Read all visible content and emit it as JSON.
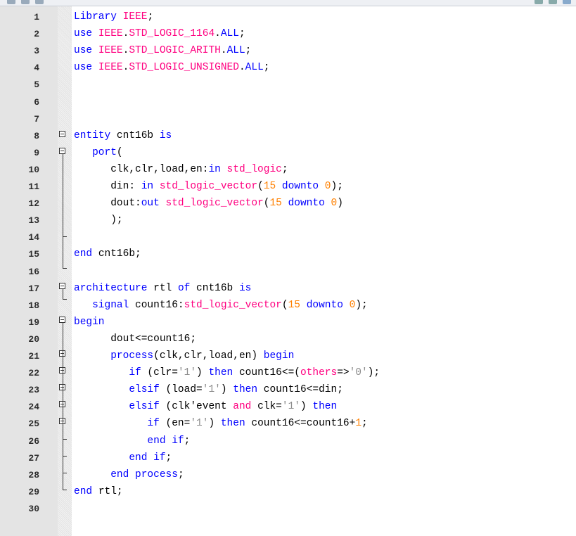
{
  "editor": {
    "line_numbers": [
      "1",
      "2",
      "3",
      "4",
      "5",
      "6",
      "7",
      "8",
      "9",
      "10",
      "11",
      "12",
      "13",
      "14",
      "15",
      "16",
      "17",
      "18",
      "19",
      "20",
      "21",
      "22",
      "23",
      "24",
      "25",
      "26",
      "27",
      "28",
      "29",
      "30"
    ],
    "lines": [
      [
        [
          "Library ",
          "kw"
        ],
        [
          "IEEE",
          "ty"
        ],
        [
          ";",
          "id"
        ]
      ],
      [
        [
          "use ",
          "kw"
        ],
        [
          "IEEE",
          "ty"
        ],
        [
          ".",
          "id"
        ],
        [
          "STD_LOGIC_1164",
          "ty"
        ],
        [
          ".",
          "id"
        ],
        [
          "ALL",
          "kw"
        ],
        [
          ";",
          "id"
        ]
      ],
      [
        [
          "use ",
          "kw"
        ],
        [
          "IEEE",
          "ty"
        ],
        [
          ".",
          "id"
        ],
        [
          "STD_LOGIC_ARITH",
          "ty"
        ],
        [
          ".",
          "id"
        ],
        [
          "ALL",
          "kw"
        ],
        [
          ";",
          "id"
        ]
      ],
      [
        [
          "use ",
          "kw"
        ],
        [
          "IEEE",
          "ty"
        ],
        [
          ".",
          "id"
        ],
        [
          "STD_LOGIC_UNSIGNED",
          "ty"
        ],
        [
          ".",
          "id"
        ],
        [
          "ALL",
          "kw"
        ],
        [
          ";",
          "id"
        ]
      ],
      [],
      [],
      [],
      [
        [
          "entity ",
          "kw"
        ],
        [
          "cnt16b ",
          "id"
        ],
        [
          "is",
          "kw"
        ]
      ],
      [
        [
          "   port",
          "kw"
        ],
        [
          "(",
          "id"
        ]
      ],
      [
        [
          "      clk,clr,load,en:",
          "id"
        ],
        [
          "in ",
          "kw"
        ],
        [
          "std_logic",
          "ty"
        ],
        [
          ";",
          "id"
        ]
      ],
      [
        [
          "      din: ",
          "id"
        ],
        [
          "in ",
          "kw"
        ],
        [
          "std_logic_vector",
          "ty"
        ],
        [
          "(",
          "id"
        ],
        [
          "15 ",
          "nm"
        ],
        [
          "downto ",
          "kw"
        ],
        [
          "0",
          "nm"
        ],
        [
          ");",
          "id"
        ]
      ],
      [
        [
          "      dout:",
          "id"
        ],
        [
          "out ",
          "kw"
        ],
        [
          "std_logic_vector",
          "ty"
        ],
        [
          "(",
          "id"
        ],
        [
          "15 ",
          "nm"
        ],
        [
          "downto ",
          "kw"
        ],
        [
          "0",
          "nm"
        ],
        [
          ")",
          "id"
        ]
      ],
      [
        [
          "      );",
          "id"
        ]
      ],
      [],
      [
        [
          "end ",
          "kw"
        ],
        [
          "cnt16b;",
          "id"
        ]
      ],
      [],
      [
        [
          "architecture ",
          "kw"
        ],
        [
          "rtl ",
          "id"
        ],
        [
          "of ",
          "kw"
        ],
        [
          "cnt16b ",
          "id"
        ],
        [
          "is",
          "kw"
        ]
      ],
      [
        [
          "   signal ",
          "kw"
        ],
        [
          "count16:",
          "id"
        ],
        [
          "std_logic_vector",
          "ty"
        ],
        [
          "(",
          "id"
        ],
        [
          "15 ",
          "nm"
        ],
        [
          "downto ",
          "kw"
        ],
        [
          "0",
          "nm"
        ],
        [
          ");",
          "id"
        ]
      ],
      [
        [
          "begin",
          "kw"
        ]
      ],
      [
        [
          "      dout<=count16;",
          "id"
        ]
      ],
      [
        [
          "      process",
          "kw"
        ],
        [
          "(clk,clr,load,en) ",
          "id"
        ],
        [
          "begin",
          "kw"
        ]
      ],
      [
        [
          "         if ",
          "kw"
        ],
        [
          "(clr=",
          "id"
        ],
        [
          "'1'",
          "st"
        ],
        [
          ") ",
          "id"
        ],
        [
          "then ",
          "kw"
        ],
        [
          "count16<=(",
          "id"
        ],
        [
          "others",
          "ty"
        ],
        [
          "=>",
          "id"
        ],
        [
          "'0'",
          "st"
        ],
        [
          ");",
          "id"
        ]
      ],
      [
        [
          "         elsif ",
          "kw"
        ],
        [
          "(load=",
          "id"
        ],
        [
          "'1'",
          "st"
        ],
        [
          ") ",
          "id"
        ],
        [
          "then ",
          "kw"
        ],
        [
          "count16<=din;",
          "id"
        ]
      ],
      [
        [
          "         elsif ",
          "kw"
        ],
        [
          "(clk'event ",
          "id"
        ],
        [
          "and ",
          "ty"
        ],
        [
          "clk=",
          "id"
        ],
        [
          "'1'",
          "st"
        ],
        [
          ") ",
          "id"
        ],
        [
          "then",
          "kw"
        ]
      ],
      [
        [
          "            if ",
          "kw"
        ],
        [
          "(en=",
          "id"
        ],
        [
          "'1'",
          "st"
        ],
        [
          ") ",
          "id"
        ],
        [
          "then ",
          "kw"
        ],
        [
          "count16<=count16+",
          "id"
        ],
        [
          "1",
          "nm"
        ],
        [
          ";",
          "id"
        ]
      ],
      [
        [
          "            end if",
          "kw"
        ],
        [
          ";",
          "id"
        ]
      ],
      [
        [
          "         end if",
          "kw"
        ],
        [
          ";",
          "id"
        ]
      ],
      [
        [
          "      end process",
          "kw"
        ],
        [
          ";",
          "id"
        ]
      ],
      [
        [
          "end ",
          "kw"
        ],
        [
          "rtl;",
          "id"
        ]
      ],
      []
    ]
  }
}
